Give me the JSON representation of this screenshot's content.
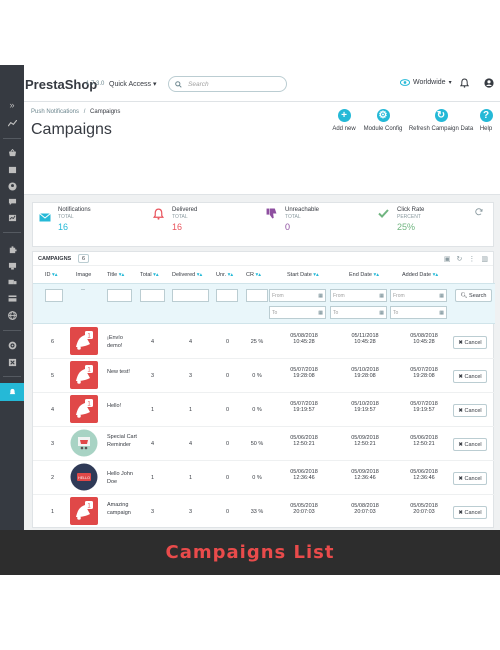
{
  "topbar": {
    "logo_text": "PrestaShop",
    "version": "1.7.3.0",
    "quick_access": "Quick Access ▾",
    "search_placeholder": "Search",
    "shop_selector": "Worldwide"
  },
  "breadcrumb": {
    "parent": "Push Notifications",
    "separator": "/",
    "current": "Campaigns"
  },
  "page_title": "Campaigns",
  "toolbar": {
    "add_new": "Add new",
    "module_config": "Module Config",
    "refresh": "Refresh Campaign Data",
    "help": "Help"
  },
  "kpis": [
    {
      "label": "Notifications",
      "sub": "TOTAL",
      "value": "16",
      "color": "#25b9d7"
    },
    {
      "label": "Delivered",
      "sub": "TOTAL",
      "value": "16",
      "color": "#e9545d"
    },
    {
      "label": "Unreachable",
      "sub": "TOTAL",
      "value": "0",
      "color": "#8e4fa0"
    },
    {
      "label": "Click Rate",
      "sub": "PERCENT",
      "value": "25%",
      "color": "#70b580"
    }
  ],
  "panel": {
    "title": "CAMPAIGNS",
    "count": "6",
    "columns": {
      "id": "ID",
      "image": "Image",
      "title": "Title",
      "total": "Total",
      "delivered": "Delivered",
      "unr": "Unr.",
      "cr": "CR",
      "start": "Start Date",
      "end": "End Date",
      "added": "Added Date"
    },
    "filters": {
      "image_dash": "--",
      "from": "From",
      "to": "To",
      "search_label": "Search"
    },
    "cancel_label": "Cancel"
  },
  "rows": [
    {
      "id": "6",
      "title": "¡Envío demo!",
      "total": "4",
      "delivered": "4",
      "unr": "0",
      "cr": "25 %",
      "start_date": "05/08/2018",
      "start_time": "10:45:28",
      "end_date": "05/11/2018",
      "end_time": "10:45:28",
      "added_date": "05/08/2018",
      "added_time": "10:45:28",
      "thumb": "red-bell"
    },
    {
      "id": "5",
      "title": "New test!",
      "total": "3",
      "delivered": "3",
      "unr": "0",
      "cr": "0 %",
      "start_date": "05/07/2018",
      "start_time": "19:28:08",
      "end_date": "05/10/2018",
      "end_time": "19:28:08",
      "added_date": "05/07/2018",
      "added_time": "19:28:08",
      "thumb": "red-bell"
    },
    {
      "id": "4",
      "title": "Hello!",
      "total": "1",
      "delivered": "1",
      "unr": "0",
      "cr": "0 %",
      "start_date": "05/07/2018",
      "start_time": "19:19:57",
      "end_date": "05/10/2018",
      "end_time": "19:19:57",
      "added_date": "05/07/2018",
      "added_time": "19:19:57",
      "thumb": "red-bell"
    },
    {
      "id": "3",
      "title": "Special Cart Reminder",
      "total": "4",
      "delivered": "4",
      "unr": "0",
      "cr": "50 %",
      "start_date": "05/06/2018",
      "start_time": "12:50:21",
      "end_date": "05/09/2018",
      "end_time": "12:50:21",
      "added_date": "05/06/2018",
      "added_time": "12:50:21",
      "thumb": "green-cart"
    },
    {
      "id": "2",
      "title": "Hello John Doe",
      "total": "1",
      "delivered": "1",
      "unr": "0",
      "cr": "0 %",
      "start_date": "05/06/2018",
      "start_time": "12:36:46",
      "end_date": "05/09/2018",
      "end_time": "12:36:46",
      "added_date": "05/06/2018",
      "added_time": "12:36:46",
      "thumb": "dark-hello"
    },
    {
      "id": "1",
      "title": "Amazing campaign",
      "total": "3",
      "delivered": "3",
      "unr": "0",
      "cr": "33 %",
      "start_date": "05/05/2018",
      "start_time": "20:07:03",
      "end_date": "05/08/2018",
      "end_time": "20:07:03",
      "added_date": "05/05/2018",
      "added_time": "20:07:03",
      "thumb": "red-bell"
    }
  ],
  "banner": {
    "text": "Campaigns List"
  },
  "colors": {
    "accent": "#25b9d7",
    "sidebar": "#363a41",
    "banner_text": "#e94b4b"
  }
}
